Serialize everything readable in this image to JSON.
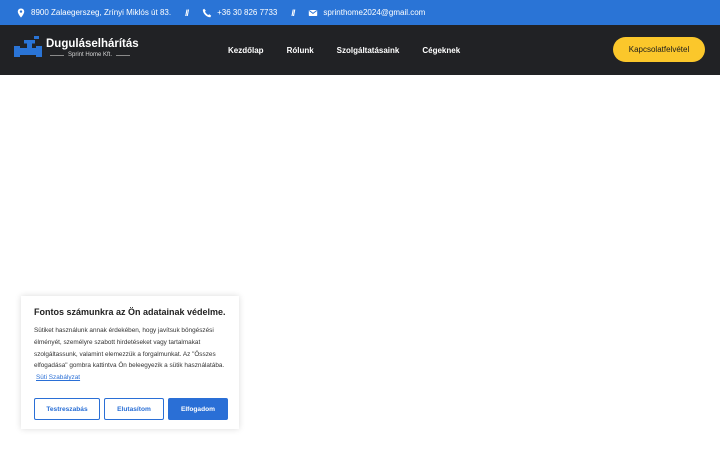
{
  "topbar": {
    "address": "8900 Zalaegerszeg, Zrínyi Miklós út 83.",
    "separator": "//",
    "phone": "+36 30 826 7733",
    "email": "sprinthome2024@gmail.com"
  },
  "header": {
    "brand": "Duguláselhárítás",
    "subbrand": "Sprint Home Kft.",
    "nav": [
      "Kezdőlap",
      "Rólunk",
      "Szolgáltatásaink",
      "Cégeknek"
    ],
    "cta": "Kapcsolatfelvétel"
  },
  "cookie": {
    "title": "Fontos számunkra az Ön adatainak védelme.",
    "text": "Sütiket használunk annak érdekében, hogy javítsuk böngészési élményét, személyre szabott hirdetéseket vagy tartalmakat szolgáltassunk, valamint elemezzük a forgalmunkat. Az \"Összes elfogadása\" gombra kattintva Ön beleegyezik a sütik használatába.",
    "policy_link": "Süti Szabályzat",
    "customize": "Testreszabás",
    "reject": "Elutasítom",
    "accept": "Elfogadom"
  },
  "colors": {
    "topbar": "#2a74d6",
    "header": "#212225",
    "cta": "#fbc72b",
    "accent": "#2a6fd6"
  },
  "icons": [
    "location-pin-icon",
    "phone-icon",
    "envelope-icon",
    "pipe-logo-icon"
  ]
}
